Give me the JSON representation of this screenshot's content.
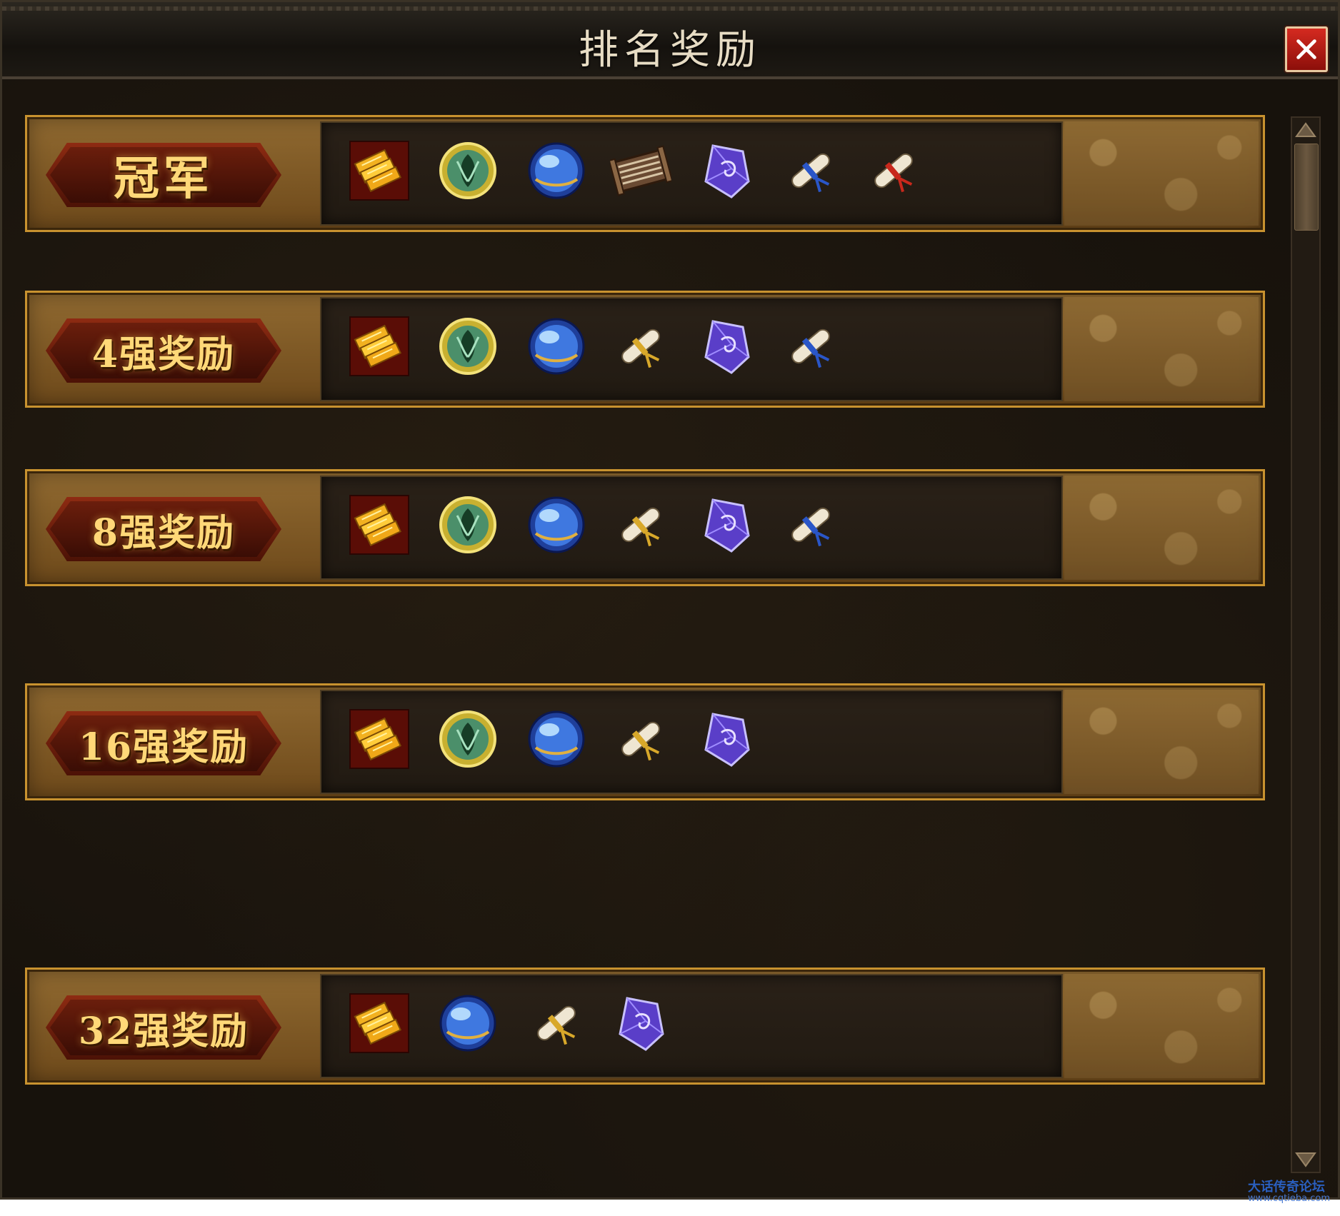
{
  "window": {
    "title": "排名奖励"
  },
  "rows": [
    {
      "rank": "冠军",
      "items": [
        "gold-ingots-icon",
        "green-crest-token-icon",
        "blue-orb-icon",
        "bamboo-scroll-icon",
        "purple-crystal-icon",
        "blue-ribbon-scroll-icon",
        "red-ribbon-scroll-icon"
      ]
    },
    {
      "rank": "4强奖励",
      "items": [
        "gold-ingots-icon",
        "green-crest-token-icon",
        "blue-orb-icon",
        "yellow-ribbon-scroll-icon",
        "purple-crystal-icon",
        "blue-ribbon-scroll-icon"
      ]
    },
    {
      "rank": "8强奖励",
      "items": [
        "gold-ingots-icon",
        "green-crest-token-icon",
        "blue-orb-icon",
        "yellow-ribbon-scroll-icon",
        "purple-crystal-icon",
        "blue-ribbon-scroll-icon"
      ]
    },
    {
      "rank": "16强奖励",
      "items": [
        "gold-ingots-icon",
        "green-crest-token-icon",
        "blue-orb-icon",
        "yellow-ribbon-scroll-icon",
        "purple-crystal-icon"
      ]
    },
    {
      "rank": "32强奖励",
      "items": [
        "gold-ingots-icon",
        "blue-orb-icon",
        "yellow-ribbon-scroll-icon",
        "purple-crystal-icon"
      ]
    }
  ],
  "watermark": {
    "name": "大话传奇论坛",
    "url": "www.cqtieba.com"
  },
  "colors": {
    "accent_gold": "#ffd878",
    "frame_gold": "#c8922f",
    "close_red": "#d52a20"
  }
}
